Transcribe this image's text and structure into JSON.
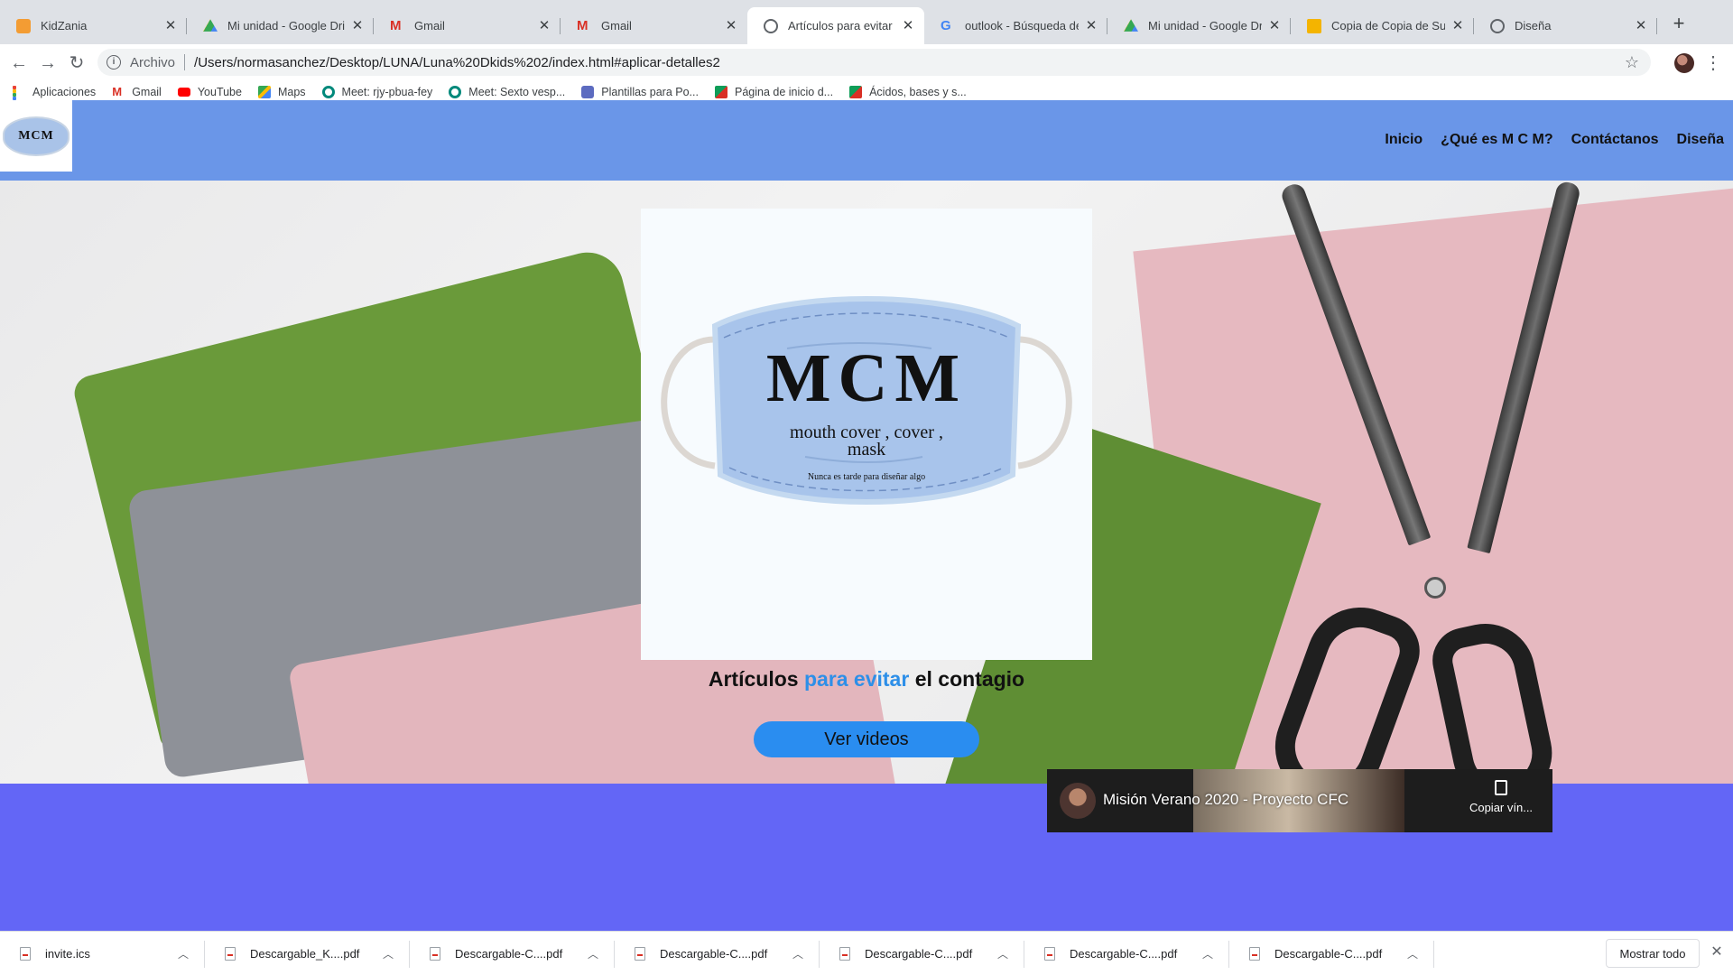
{
  "browser": {
    "tabs": [
      {
        "title": "KidZania",
        "favicon": "kidzania-icon",
        "color": "#f39c33"
      },
      {
        "title": "Mi unidad - Google Drive",
        "favicon": "google-drive-icon",
        "color": "#1fa463"
      },
      {
        "title": "Gmail",
        "favicon": "gmail-icon",
        "color": "#d93025"
      },
      {
        "title": "Gmail",
        "favicon": "gmail-icon",
        "color": "#d93025"
      },
      {
        "title": "Artículos para evitar el contagio",
        "favicon": "globe-icon",
        "color": "#5f6368",
        "active": true
      },
      {
        "title": "outlook - Búsqueda de Google",
        "favicon": "google-icon",
        "color": "#4285f4"
      },
      {
        "title": "Mi unidad - Google Drive",
        "favicon": "google-drive-icon",
        "color": "#1fa463"
      },
      {
        "title": "Copia de Copia de Superman",
        "favicon": "google-slides-icon",
        "color": "#f4b400"
      },
      {
        "title": "Diseña",
        "favicon": "globe-icon",
        "color": "#5f6368"
      }
    ],
    "new_tab_symbol": "+",
    "address": {
      "scheme_label": "Archivo",
      "url": "/Users/normasanchez/Desktop/LUNA/Luna%20Dkids%202/index.html#aplicar-detalles2"
    },
    "bookmarks": [
      {
        "label": "Aplicaciones",
        "icon": "apps-grid-icon",
        "color": "#5f6368"
      },
      {
        "label": "Gmail",
        "icon": "gmail-icon",
        "color": "#d93025"
      },
      {
        "label": "YouTube",
        "icon": "youtube-icon",
        "color": "#ff0000"
      },
      {
        "label": "Maps",
        "icon": "maps-icon",
        "color": "#34a853"
      },
      {
        "label": "Meet: rjy-pbua-fey",
        "icon": "meet-icon",
        "color": "#00897b"
      },
      {
        "label": "Meet: Sexto vesp...",
        "icon": "meet-icon",
        "color": "#00897b"
      },
      {
        "label": "Plantillas para Po...",
        "icon": "templates-icon",
        "color": "#5c6bc0"
      },
      {
        "label": "Página de inicio d...",
        "icon": "classroom-icon",
        "color": "#0f9d58"
      },
      {
        "label": "Ácidos, bases y s...",
        "icon": "classroom-icon",
        "color": "#0f9d58"
      }
    ]
  },
  "site": {
    "logo_text": "MCM",
    "nav": [
      "Inicio",
      "¿Qué es M C M?",
      "Contáctanos",
      "Diseña"
    ],
    "nav_bg": "#6a96e8",
    "card": {
      "brand": "MCM",
      "tagline_line1": "mouth cover , cover ,",
      "tagline_line2": "mask",
      "slogan": "Nunca es tarde para diseñar algo"
    },
    "hero_title": {
      "part1": "Artículos",
      "accent": "para evitar",
      "part2": "el contagio"
    },
    "accent_color": "#2d8fe8",
    "cta_label": "Ver videos",
    "band_color": "#6366f6",
    "video": {
      "title": "Misión Verano 2020 - Proyecto CFC",
      "copy_label": "Copiar vín..."
    }
  },
  "downloads": {
    "items": [
      "invite.ics",
      "Descargable_K....pdf",
      "Descargable-C....pdf",
      "Descargable-C....pdf",
      "Descargable-C....pdf",
      "Descargable-C....pdf",
      "Descargable-C....pdf"
    ],
    "show_all_label": "Mostrar todo"
  }
}
